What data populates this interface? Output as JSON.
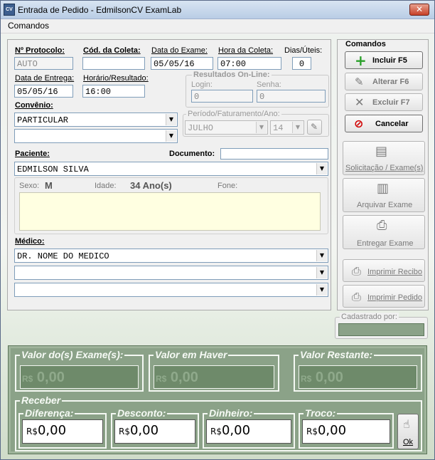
{
  "window": {
    "title": "Entrada de Pedido - EdmilsonCV ExamLab",
    "icon": "app-icon",
    "close": "✕"
  },
  "menu": {
    "comandos": "Comandos"
  },
  "form": {
    "protocolo": {
      "label": "Nº Protocolo:",
      "value": "AUTO"
    },
    "cod_coleta": {
      "label": "Cód. da Coleta:",
      "value": ""
    },
    "data_exame": {
      "label": "Data do Exame:",
      "value": "05/05/16"
    },
    "hora_coleta": {
      "label": "Hora da Coleta:",
      "value": "07:00"
    },
    "dias_uteis": {
      "label": "Dias/Úteis:",
      "value": "0"
    },
    "data_entrega": {
      "label": "Data de Entrega:",
      "value": "05/05/16"
    },
    "horario_resultado": {
      "label": "Horário/Resultado:",
      "value": "16:00"
    },
    "resultados_online": {
      "title": "Resultados On-Line:",
      "login_label": "Login:",
      "login_value": "0",
      "senha_label": "Senha:",
      "senha_value": "0"
    },
    "convenio": {
      "label": "Convênio:",
      "value": "PARTICULAR",
      "second_value": ""
    },
    "periodo": {
      "title": "Período/Faturamento/Ano:",
      "month": "JULHO",
      "day": "14"
    },
    "paciente": {
      "label": "Paciente:",
      "value": "EDMILSON SILVA",
      "documento_label": "Documento:",
      "documento_value": ""
    },
    "info": {
      "sexo_label": "Sexo:",
      "sexo_value": "M",
      "idade_label": "Idade:",
      "idade_value": "34 Ano(s)",
      "fone_label": "Fone:"
    },
    "medico": {
      "label": "Médico:",
      "values": [
        "DR. NOME DO MEDICO",
        "",
        ""
      ]
    }
  },
  "commands": {
    "title": "Comandos",
    "incluir": "Incluir  F5",
    "alterar": "Alterar  F6",
    "excluir": "Excluir  F7",
    "cancelar": "Cancelar",
    "solicitacao": "Solicitação / Exame(s)",
    "arquivar": "Arquivar Exame",
    "entregar": "Entregar Exame",
    "imprimir_recibo": "Imprimir Recibo",
    "imprimir_pedido": "Imprimir Pedido",
    "cadastrado_por": "Cadastrado por:"
  },
  "values": {
    "valor_exames": {
      "label": "Valor do(s) Exame(s):",
      "currency": "R$",
      "amount": "0,00"
    },
    "valor_haver": {
      "label": "Valor em Haver",
      "currency": "R$",
      "amount": "0,00"
    },
    "valor_restante": {
      "label": "Valor Restante:",
      "currency": "R$",
      "amount": "0,00"
    },
    "receber": {
      "label": "Receber"
    },
    "diferenca": {
      "label": "Diferença:",
      "currency": "R$",
      "amount": "0,00"
    },
    "desconto": {
      "label": "Desconto:",
      "currency": "R$",
      "amount": "0,00"
    },
    "dinheiro": {
      "label": "Dinheiro:",
      "currency": "R$",
      "amount": "0,00"
    },
    "troco": {
      "label": "Troco:",
      "currency": "R$",
      "amount": "0,00"
    },
    "ok": "Ok"
  },
  "colors": {
    "bottom_panel": "#8ba288",
    "incluir_icon": "#2aa02a",
    "cancelar_icon": "#d10000"
  }
}
